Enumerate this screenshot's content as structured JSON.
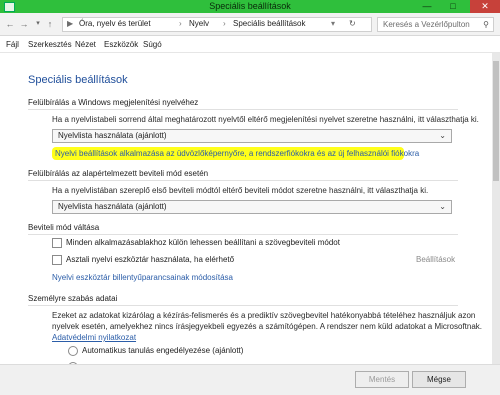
{
  "window": {
    "title": "Speciális beállítások"
  },
  "address": {
    "crumbs": [
      "Óra, nyelv és terület",
      "Nyelv",
      "Speciális beállítások"
    ],
    "search_placeholder": "Keresés a Vezérlőpulton"
  },
  "menu": [
    "Fájl",
    "Szerkesztés",
    "Nézet",
    "Eszközök",
    "Súgó"
  ],
  "page": {
    "title": "Speciális beállítások",
    "display_override": {
      "heading": "Felülbírálás a Windows megjelenítési nyelvéhez",
      "description": "Ha a nyelvlistabeli sorrend által meghatározott nyelvtől eltérő megjelenítési nyelvet szeretne használni, itt választhatja ki.",
      "selected": "Nyelvlista használata (ajánlott)",
      "apply_link": "Nyelvi beállítások alkalmazása az üdvözlőképernyőre, a rendszerfiókokra és az új felhasználói fiókokra"
    },
    "input_override": {
      "heading": "Felülbírálás az alapértelmezett beviteli mód esetén",
      "description": "Ha a nyelvlistában szereplő első beviteli módtól eltérő beviteli módot szeretne használni, itt választhatja ki.",
      "selected": "Nyelvlista használata (ajánlott)"
    },
    "switching": {
      "heading": "Beviteli mód váltása",
      "option1": "Minden alkalmazásablakhoz külön lehessen beállítani a szövegbeviteli módot",
      "option2": "Asztali nyelvi eszköztár használata, ha elérhető",
      "options_link": "Beállítások",
      "hotkeys_link": "Nyelvi eszköztár billentyűparancsainak módosítása"
    },
    "personalization": {
      "heading": "Személyre szabás adatai",
      "line1": "Ezeket az adatokat kizárólag a kézírás-felismerés és a prediktív szövegbevitel hatékonyabbá tételéhez használjuk azon",
      "line2": "nyelvek esetén, amelyekhez nincs írásjegyekbeli egyezés a számítógépen. A rendszer nem küld adatokat a Microsoftnak.",
      "privacy_link": "Adatvédelmi nyilatkozat",
      "radio1": "Automatikus tanulás engedélyezése (ajánlott)"
    }
  },
  "footer": {
    "cancel": "Mentés",
    "ok": "Mégse"
  }
}
